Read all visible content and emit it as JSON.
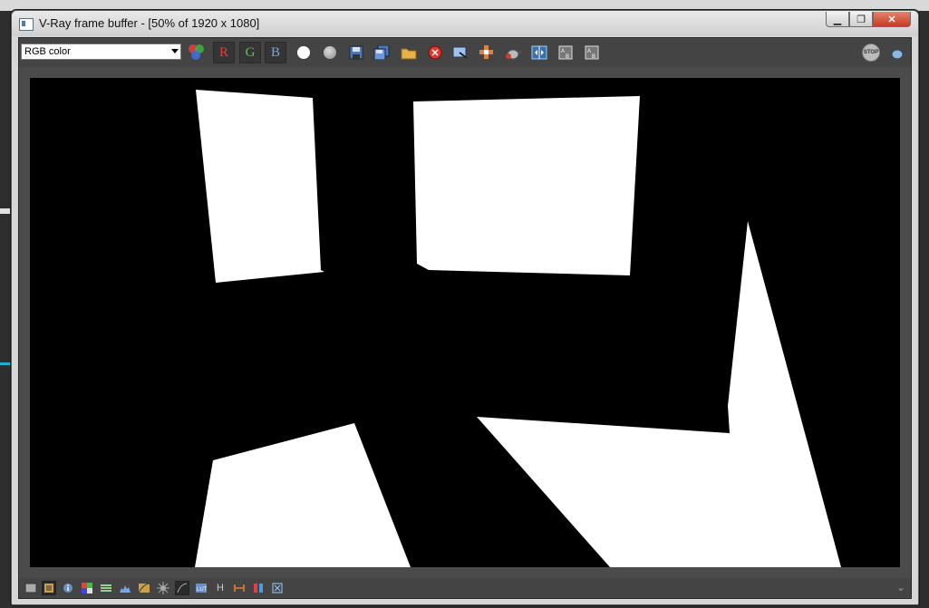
{
  "window": {
    "title": "V-Ray frame buffer - [50% of 1920 x 1080]",
    "minimize_glyph": "▁",
    "maximize_glyph": "❐",
    "close_glyph": "✕"
  },
  "toolbar": {
    "channel_select_value": "RGB color",
    "channel_r": "R",
    "channel_g": "G",
    "channel_b": "B",
    "stop_label": "STOP",
    "icons": [
      "rgb-channels-icon",
      "red-channel-icon",
      "green-channel-icon",
      "blue-channel-icon",
      "white-circle-icon",
      "grey-circle-icon",
      "save-icon",
      "save-all-icon",
      "open-icon",
      "clear-icon",
      "copy-to-max-icon",
      "track-mouse-icon",
      "render-teapot-icon",
      "compare-ab-icon",
      "ab-a-icon",
      "ab-b-icon",
      "stop-icon",
      "render-icon"
    ]
  },
  "statusbar": {
    "h_label": "H",
    "icons": [
      "display-correction-icon",
      "history-icon",
      "info-icon",
      "pixel-info-icon",
      "color-lut-icon",
      "histogram-icon",
      "curves-icon",
      "lens-effects-icon",
      "stereo-icon",
      "ocio-icon",
      "lut-icon",
      "hsv-icon",
      "exposure-icon",
      "color-balance-icon",
      "denoise-icon",
      "expand-icon"
    ]
  },
  "colors": {
    "render_background": "#000000",
    "render_shapes": "#ffffff",
    "clear_button": "#d83b2b"
  }
}
